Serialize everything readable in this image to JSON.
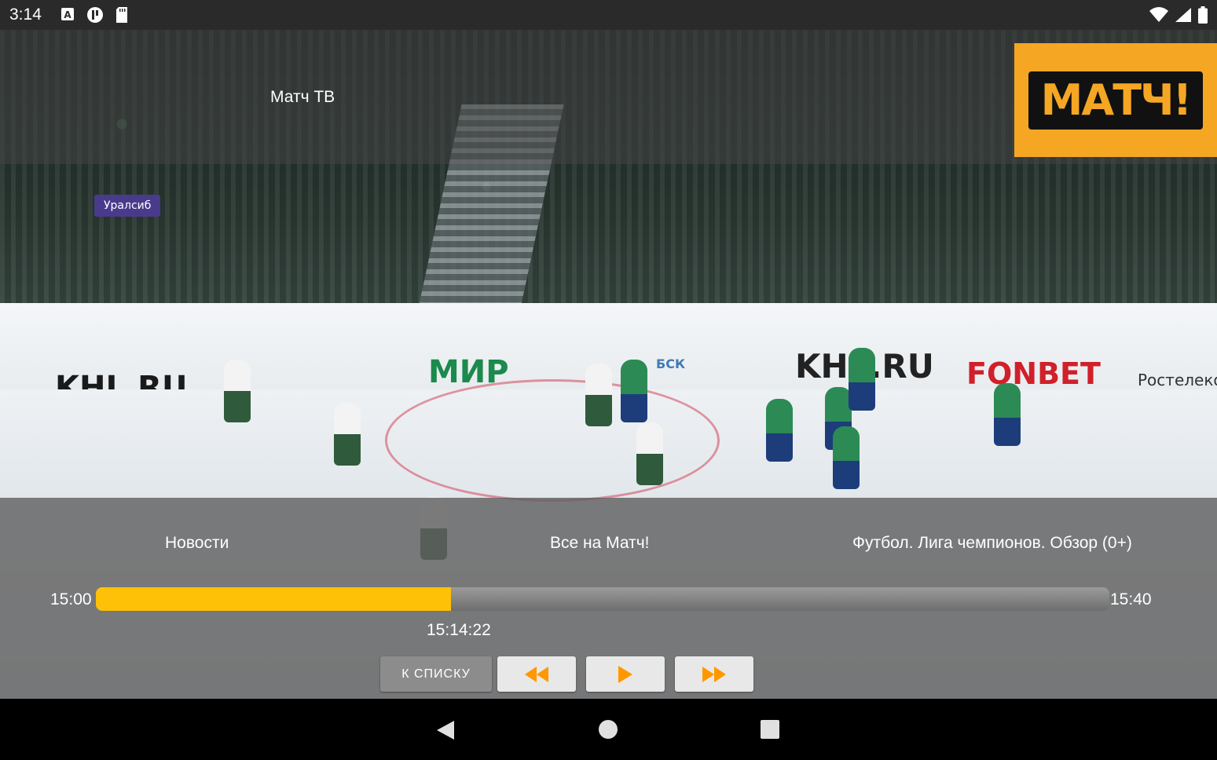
{
  "status_bar": {
    "time": "3:14"
  },
  "header": {
    "channel_name": "Матч ТВ",
    "logo_text": "МАТЧ!"
  },
  "video": {
    "boards": [
      "KHL.RU",
      "МИР",
      "KHL.RU",
      "FONBET",
      "БСК",
      "Уралсиб",
      "Ростелеком"
    ]
  },
  "schedule": {
    "previous": "Новости",
    "current": "Все на Матч!",
    "next": "Футбол. Лига чемпионов. Обзор (0+)"
  },
  "progress": {
    "start": "15:00",
    "end": "15:40",
    "current": "15:14:22",
    "fraction": 0.35
  },
  "controls": {
    "list_label": "К СПИСКУ"
  },
  "colors": {
    "accent": "#ffc107",
    "logo_bg": "#f5a623"
  }
}
